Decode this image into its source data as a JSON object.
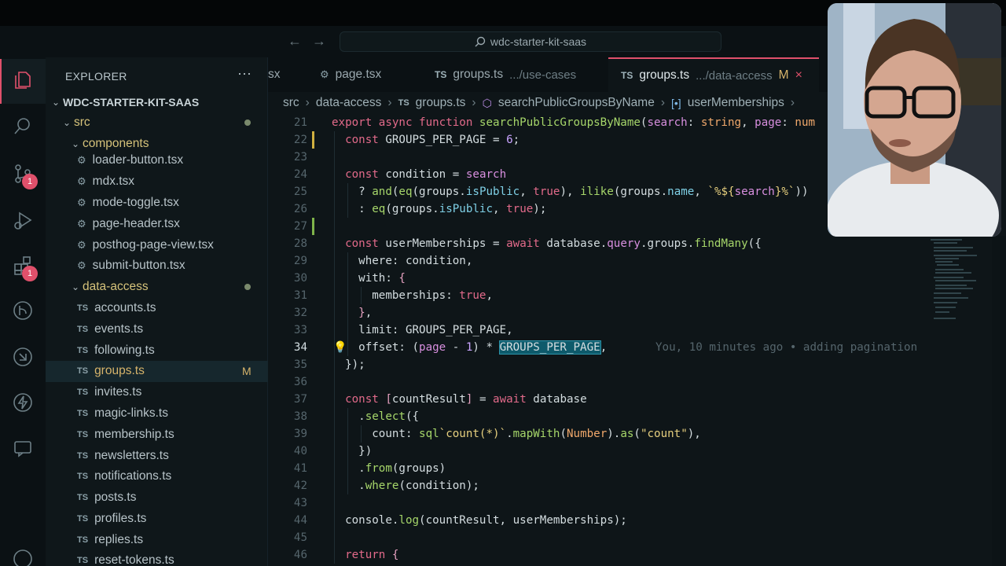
{
  "window": {
    "search_text": "wdc-starter-kit-saas"
  },
  "activity": {
    "badge_source_control": "1",
    "badge_extensions": "1"
  },
  "sidebar": {
    "title": "EXPLORER",
    "more": "···",
    "root": "WDC-STARTER-KIT-SAAS",
    "src": "src",
    "components": "components",
    "component_files": [
      "loader-button.tsx",
      "mdx.tsx",
      "mode-toggle.tsx",
      "page-header.tsx",
      "posthog-page-view.tsx",
      "submit-button.tsx"
    ],
    "data_access": "data-access",
    "data_access_files": [
      "accounts.ts",
      "events.ts",
      "following.ts",
      "groups.ts",
      "invites.ts",
      "magic-links.ts",
      "membership.ts",
      "newsletters.ts",
      "notifications.ts",
      "posts.ts",
      "profiles.ts",
      "replies.ts",
      "reset-tokens.ts"
    ],
    "file_tag": "TS",
    "modified_badge": "M"
  },
  "tabs": [
    {
      "label": "sx"
    },
    {
      "label": "page.tsx"
    },
    {
      "tag": "TS",
      "label": "groups.ts",
      "hint": ".../use-cases"
    },
    {
      "tag": "TS",
      "label": "groups.ts",
      "hint": ".../data-access",
      "mod": "M",
      "close": "×"
    }
  ],
  "breadcrumb": {
    "items": [
      "src",
      "data-access",
      "groups.ts",
      "searchPublicGroupsByName",
      "userMemberships"
    ],
    "sep": "›",
    "tag": "TS"
  },
  "editor": {
    "line_numbers": [
      "21",
      "22",
      "23",
      "24",
      "25",
      "26",
      "27",
      "28",
      "29",
      "30",
      "31",
      "32",
      "33",
      "34",
      "35",
      "36",
      "37",
      "38",
      "39",
      "40",
      "41",
      "42",
      "43",
      "44",
      "45",
      "46"
    ],
    "blame": "You, 10 minutes ago • adding pagination"
  }
}
